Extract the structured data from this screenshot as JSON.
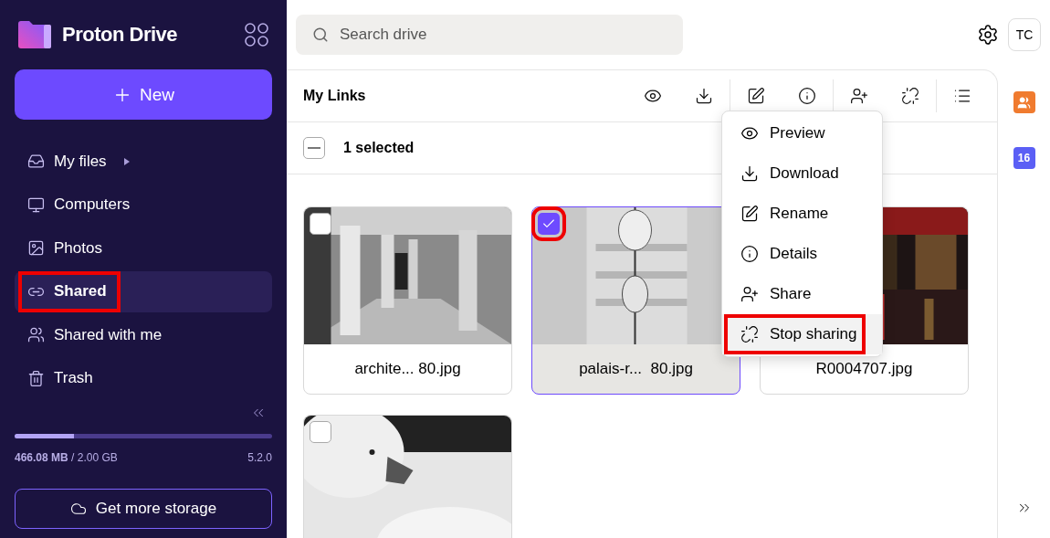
{
  "app": {
    "name": "Proton Drive"
  },
  "sidebar": {
    "new_button": "New",
    "items": [
      {
        "label": "My files",
        "selected": false,
        "expandable": true,
        "highlighted": false
      },
      {
        "label": "Computers",
        "selected": false,
        "expandable": false,
        "highlighted": false
      },
      {
        "label": "Photos",
        "selected": false,
        "expandable": false,
        "highlighted": false
      },
      {
        "label": "Shared",
        "selected": true,
        "expandable": false,
        "highlighted": true
      },
      {
        "label": "Shared with me",
        "selected": false,
        "expandable": false,
        "highlighted": false
      },
      {
        "label": "Trash",
        "selected": false,
        "expandable": false,
        "highlighted": false
      }
    ],
    "storage": {
      "used": "466.08 MB",
      "total": "/ 2.00 GB",
      "version": "5.2.0",
      "level": 0.23
    },
    "get_storage": "Get more storage"
  },
  "search": {
    "placeholder": "Search drive"
  },
  "avatar": "TC",
  "toolbar": {
    "title": "My Links"
  },
  "selection": {
    "label": "1 selected",
    "partial": true
  },
  "files": [
    {
      "name": "archite... 80.jpg",
      "selected": false,
      "highlighted": false
    },
    {
      "name": "palais-r...  80.jpg",
      "selected": true,
      "highlighted": true
    },
    {
      "name": "R0004707.jpg",
      "selected": false
    },
    {
      "selected": false,
      "highlighted": false
    }
  ],
  "context_menu": {
    "items": [
      {
        "label": "Preview",
        "highlighted": false
      },
      {
        "label": "Download",
        "highlighted": false
      },
      {
        "label": "Rename",
        "highlighted": false
      },
      {
        "label": "Details",
        "highlighted": false
      },
      {
        "label": "Share",
        "highlighted": false
      },
      {
        "label": "Stop sharing",
        "highlighted": true
      }
    ]
  },
  "rail": {
    "calendar_badge": "16"
  }
}
